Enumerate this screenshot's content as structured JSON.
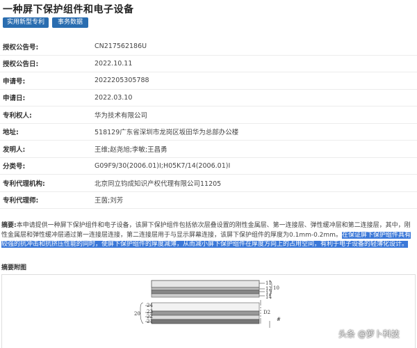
{
  "title": "一种屏下保护组件和电子设备",
  "buttons": {
    "patent_type": "实用新型专利",
    "affairs": "事务数据"
  },
  "fields": [
    {
      "label": "授权公告号:",
      "value": "CN217562186U"
    },
    {
      "label": "授权公告日:",
      "value": "2022.10.11"
    },
    {
      "label": "申请号:",
      "value": "2022205305788"
    },
    {
      "label": "申请日:",
      "value": "2022.03.10"
    },
    {
      "label": "专利权人:",
      "value": "华为技术有限公司"
    },
    {
      "label": "地址:",
      "value": "518129广东省深圳市龙岗区坂田华为总部办公楼"
    },
    {
      "label": "发明人:",
      "value": "王维;赵尧旭;李敏;王昌勇"
    },
    {
      "label": "分类号:",
      "value": "G09F9/30(2006.01)I;H05K7/14(2006.01)I"
    },
    {
      "label": "专利代理机构:",
      "value": "北京同立钧成知识产权代理有限公司11205"
    },
    {
      "label": "专利代理师:",
      "value": "王茵;刘芳"
    }
  ],
  "abstract": {
    "label": "摘要:",
    "text_plain": "本申请提供一种屏下保护组件和电子设备，该屏下保护组件包括依次层叠设置的刚性金属层、第一连接层、弹性缓冲层和第二连接层，其中，刚性金属层和弹性缓冲层通过第一连接层连接，第二连接层用于与显示屏幕连接，该屏下保护组件的厚度为0.1mm-0.2mm。",
    "text_highlight": "在保证屏下保护组件具有较强的抗冲击和抗挤压性能的同时，使屏下保护组件的厚度减薄，从而减小屏下保护组件在厚度方向上的占用空间，有利于电子设备的轻薄化设计。"
  },
  "figure": {
    "label": "摘要附图",
    "callouts": {
      "n11": "11",
      "n12": "12",
      "n13": "13",
      "n14": "14",
      "n10": "10",
      "n20": "20",
      "n21": "21",
      "n22": "22",
      "n23": "23",
      "n24": "24",
      "d2": "D2",
      "hash": "#"
    }
  },
  "watermark": "头条 @萝卜科技"
}
